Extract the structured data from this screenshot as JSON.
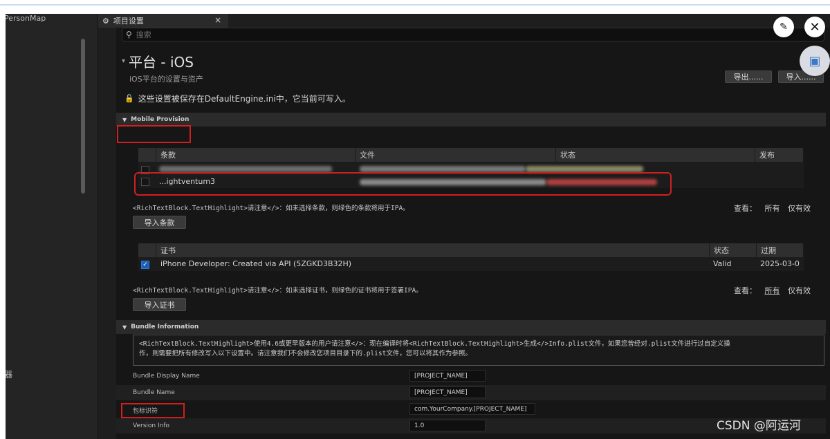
{
  "left_panel": {
    "title": "PersonMap",
    "cut_label": "器"
  },
  "tab": {
    "icon": "⚙",
    "label": "项目设置",
    "close": "×"
  },
  "search": {
    "placeholder": "搜索"
  },
  "header": {
    "title": "平台 - iOS",
    "subtitle": "iOS平台的设置与资产",
    "export_label": "导出......",
    "import_label": "导入......",
    "lock_notice": "这些设置被保存在DefaultEngine.ini中，它当前可写入。"
  },
  "mobile_provision": {
    "section_title": "Mobile Provision",
    "columns": [
      "条款",
      "文件",
      "状态",
      "发布"
    ],
    "rows": [
      {
        "name": "",
        "file": "",
        "status": ""
      },
      {
        "name": "...ightventum3",
        "file": "",
        "status": ""
      }
    ],
    "hint": "<RichTextBlock.TextHighlight>请注意</>：如未选择条款，则绿色的条款将用于IPA。",
    "view_label": "查看：",
    "view_all": "所有",
    "view_valid": "仅有效",
    "import_button": "导入条款"
  },
  "certificates": {
    "columns": [
      "证书",
      "状态",
      "过期"
    ],
    "rows": [
      {
        "checked": true,
        "name": "iPhone Developer: Created via API (5ZGKD3B32H)",
        "status": "Valid",
        "expires": "2025-03-0"
      }
    ],
    "hint": "<RichTextBlock.TextHighlight>请注意</>：如未选择证书，则绿色的证书将用于签署IPA。",
    "view_label": "查看：",
    "view_all": "所有",
    "view_valid": "仅有效",
    "import_button": "导入证书"
  },
  "bundle": {
    "section_title": "Bundle Information",
    "info_line1": "<RichTextBlock.TextHighlight>使用4.6或更早版本的用户请注意</>：现在编译时将<RichTextBlock.TextHighlight>生成</>Info.plist文件，如果您曾经对.plist文件进行过自定义操",
    "info_line2": "作，则需要把所有修改写入以下设置中。请注意我们不会修改您项目目录下的.plist文件，您可以将其作为参照。",
    "props": [
      {
        "label": "Bundle Display Name",
        "value": "[PROJECT_NAME]"
      },
      {
        "label": "Bundle Name",
        "value": "[PROJECT_NAME]"
      },
      {
        "label": "包标识符",
        "value": "com.YourCompany.[PROJECT_NAME]"
      },
      {
        "label": "Version Info",
        "value": "1.0"
      }
    ]
  },
  "watermark": "CSDN @阿运河",
  "colors": {
    "highlight_red": "#d11f1f",
    "checkbox_blue": "#1b5fb7"
  }
}
